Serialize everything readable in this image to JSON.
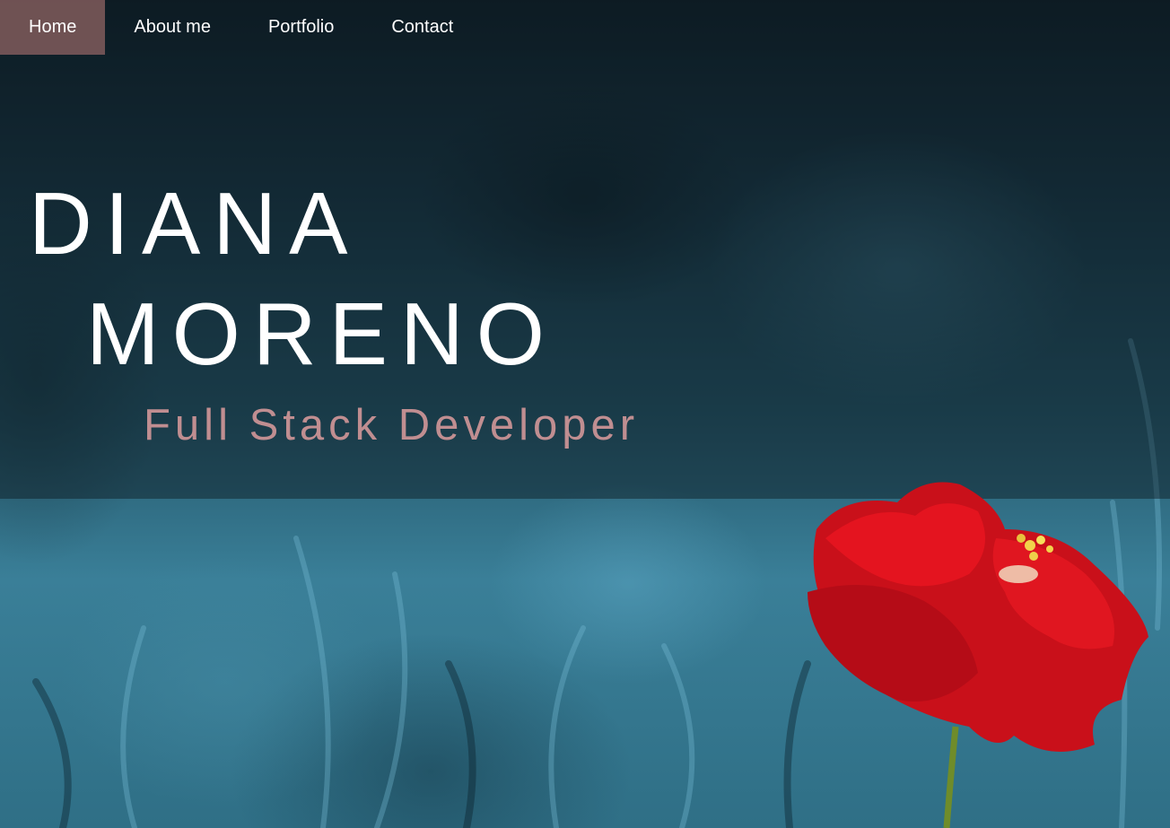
{
  "nav": {
    "items": [
      {
        "label": "Home",
        "active": true
      },
      {
        "label": "About me",
        "active": false
      },
      {
        "label": "Portfolio",
        "active": false
      },
      {
        "label": "Contact",
        "active": false
      }
    ]
  },
  "hero": {
    "first_name": "DIANA",
    "last_name": "MORENO",
    "subtitle": "Full Stack Developer"
  },
  "colors": {
    "nav_active_bg": "#855e5e",
    "subtitle": "#c08e91",
    "background": "#2f6a80",
    "flower": "#d8101c"
  },
  "images": {
    "background": "teal meadow with red poppy flower"
  }
}
